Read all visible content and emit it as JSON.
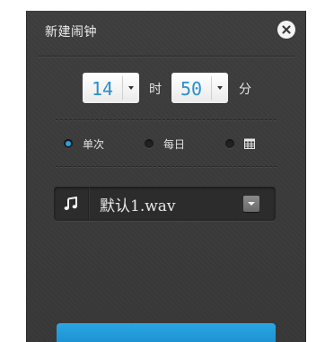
{
  "dialog": {
    "title": "新建闹钟",
    "close_icon": "close-icon"
  },
  "time": {
    "hour": "14",
    "hour_unit": "时",
    "minute": "50",
    "minute_unit": "分"
  },
  "repeat": {
    "selected": "once",
    "options": [
      {
        "id": "once",
        "label": "单次",
        "checked": true
      },
      {
        "id": "daily",
        "label": "每日",
        "checked": false
      },
      {
        "id": "calendar",
        "label": "",
        "icon": "calendar-icon",
        "checked": false
      }
    ]
  },
  "sound": {
    "icon": "music-note-icon",
    "value": "默认1.wav"
  },
  "colors": {
    "accent": "#2a9fe0",
    "dialog_bg": "#3b3b3b"
  }
}
